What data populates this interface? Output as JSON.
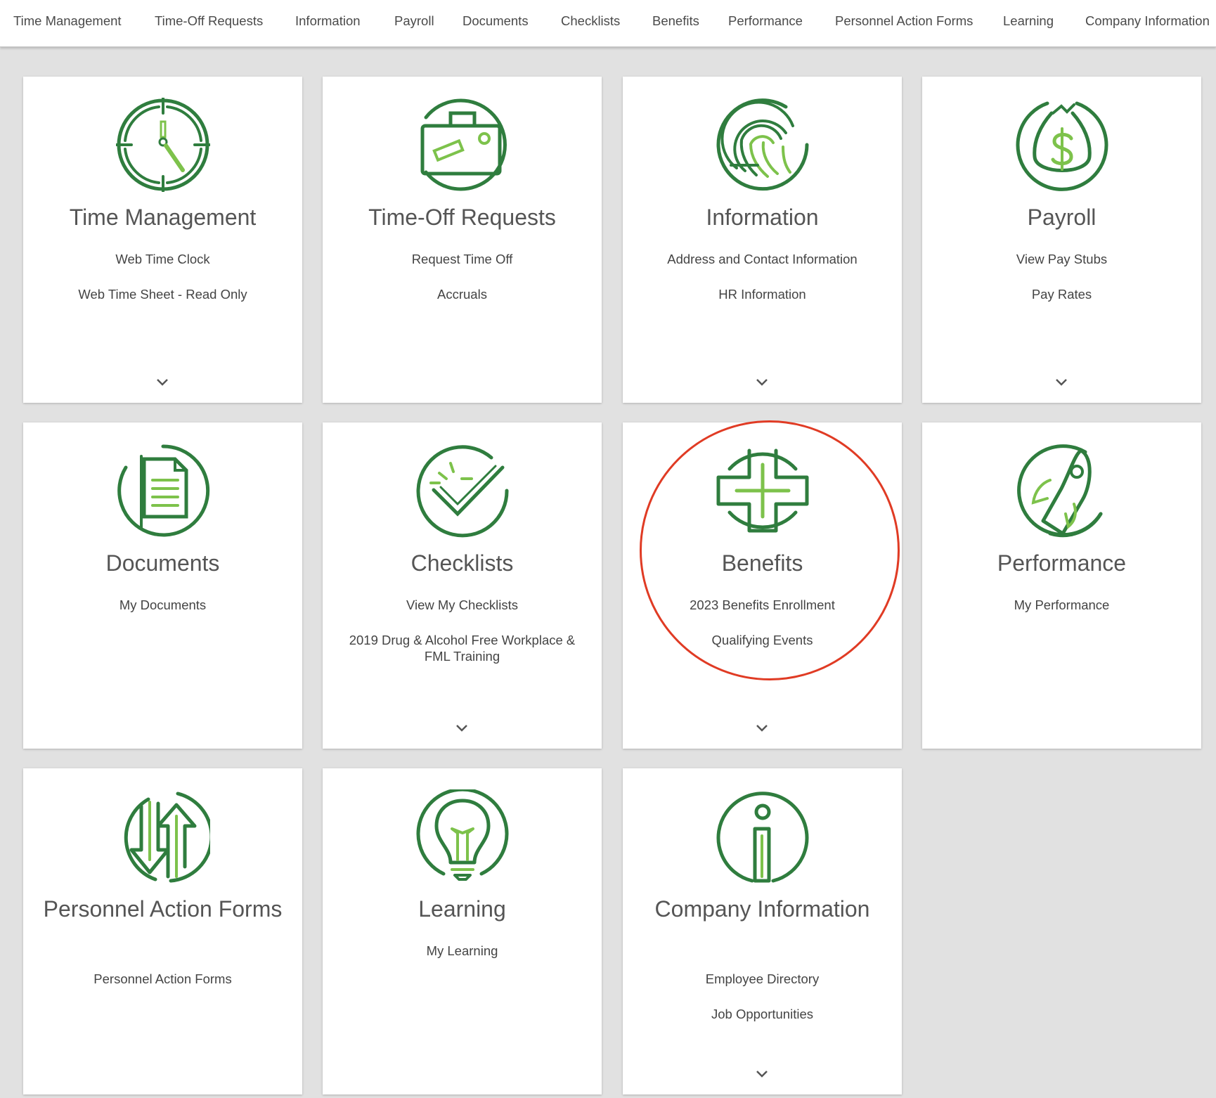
{
  "nav": {
    "items": [
      "Time Management",
      "Time-Off Requests",
      "Information",
      "Payroll",
      "Documents",
      "Checklists",
      "Benefits",
      "Performance",
      "Personnel Action Forms",
      "Learning",
      "Company Information"
    ]
  },
  "theme": {
    "dark_green": "#2f7d3e",
    "light_green": "#7dc24b",
    "highlight": "#e03b24"
  },
  "cards": [
    {
      "title": "Time Management",
      "icon": "clock-icon",
      "links": [
        "Web Time Clock",
        "Web Time Sheet - Read Only"
      ],
      "expandable": true
    },
    {
      "title": "Time-Off Requests",
      "icon": "suitcase-icon",
      "links": [
        "Request Time Off",
        "Accruals"
      ],
      "expandable": false
    },
    {
      "title": "Information",
      "icon": "fingerprint-icon",
      "links": [
        "Address and Contact Information",
        "HR Information"
      ],
      "expandable": true
    },
    {
      "title": "Payroll",
      "icon": "money-bag-icon",
      "links": [
        "View Pay Stubs",
        "Pay Rates"
      ],
      "expandable": true
    },
    {
      "title": "Documents",
      "icon": "document-icon",
      "links": [
        "My Documents"
      ],
      "expandable": false
    },
    {
      "title": "Checklists",
      "icon": "checkmark-icon",
      "links": [
        "View My Checklists",
        "2019 Drug & Alcohol Free Workplace & FML Training"
      ],
      "expandable": true
    },
    {
      "title": "Benefits",
      "icon": "medical-cross-icon",
      "links": [
        "2023 Benefits Enrollment",
        "Qualifying Events"
      ],
      "expandable": true,
      "highlighted": true
    },
    {
      "title": "Performance",
      "icon": "rocket-icon",
      "links": [
        "My Performance"
      ],
      "expandable": false
    },
    {
      "title": "Personnel Action Forms",
      "icon": "transfer-arrows-icon",
      "links": [
        "Personnel Action Forms"
      ],
      "expandable": false
    },
    {
      "title": "Learning",
      "icon": "lightbulb-icon",
      "links": [
        "My Learning"
      ],
      "expandable": false
    },
    {
      "title": "Company Information",
      "icon": "info-icon",
      "links": [
        "Employee Directory",
        "Job Opportunities"
      ],
      "expandable": true
    }
  ]
}
